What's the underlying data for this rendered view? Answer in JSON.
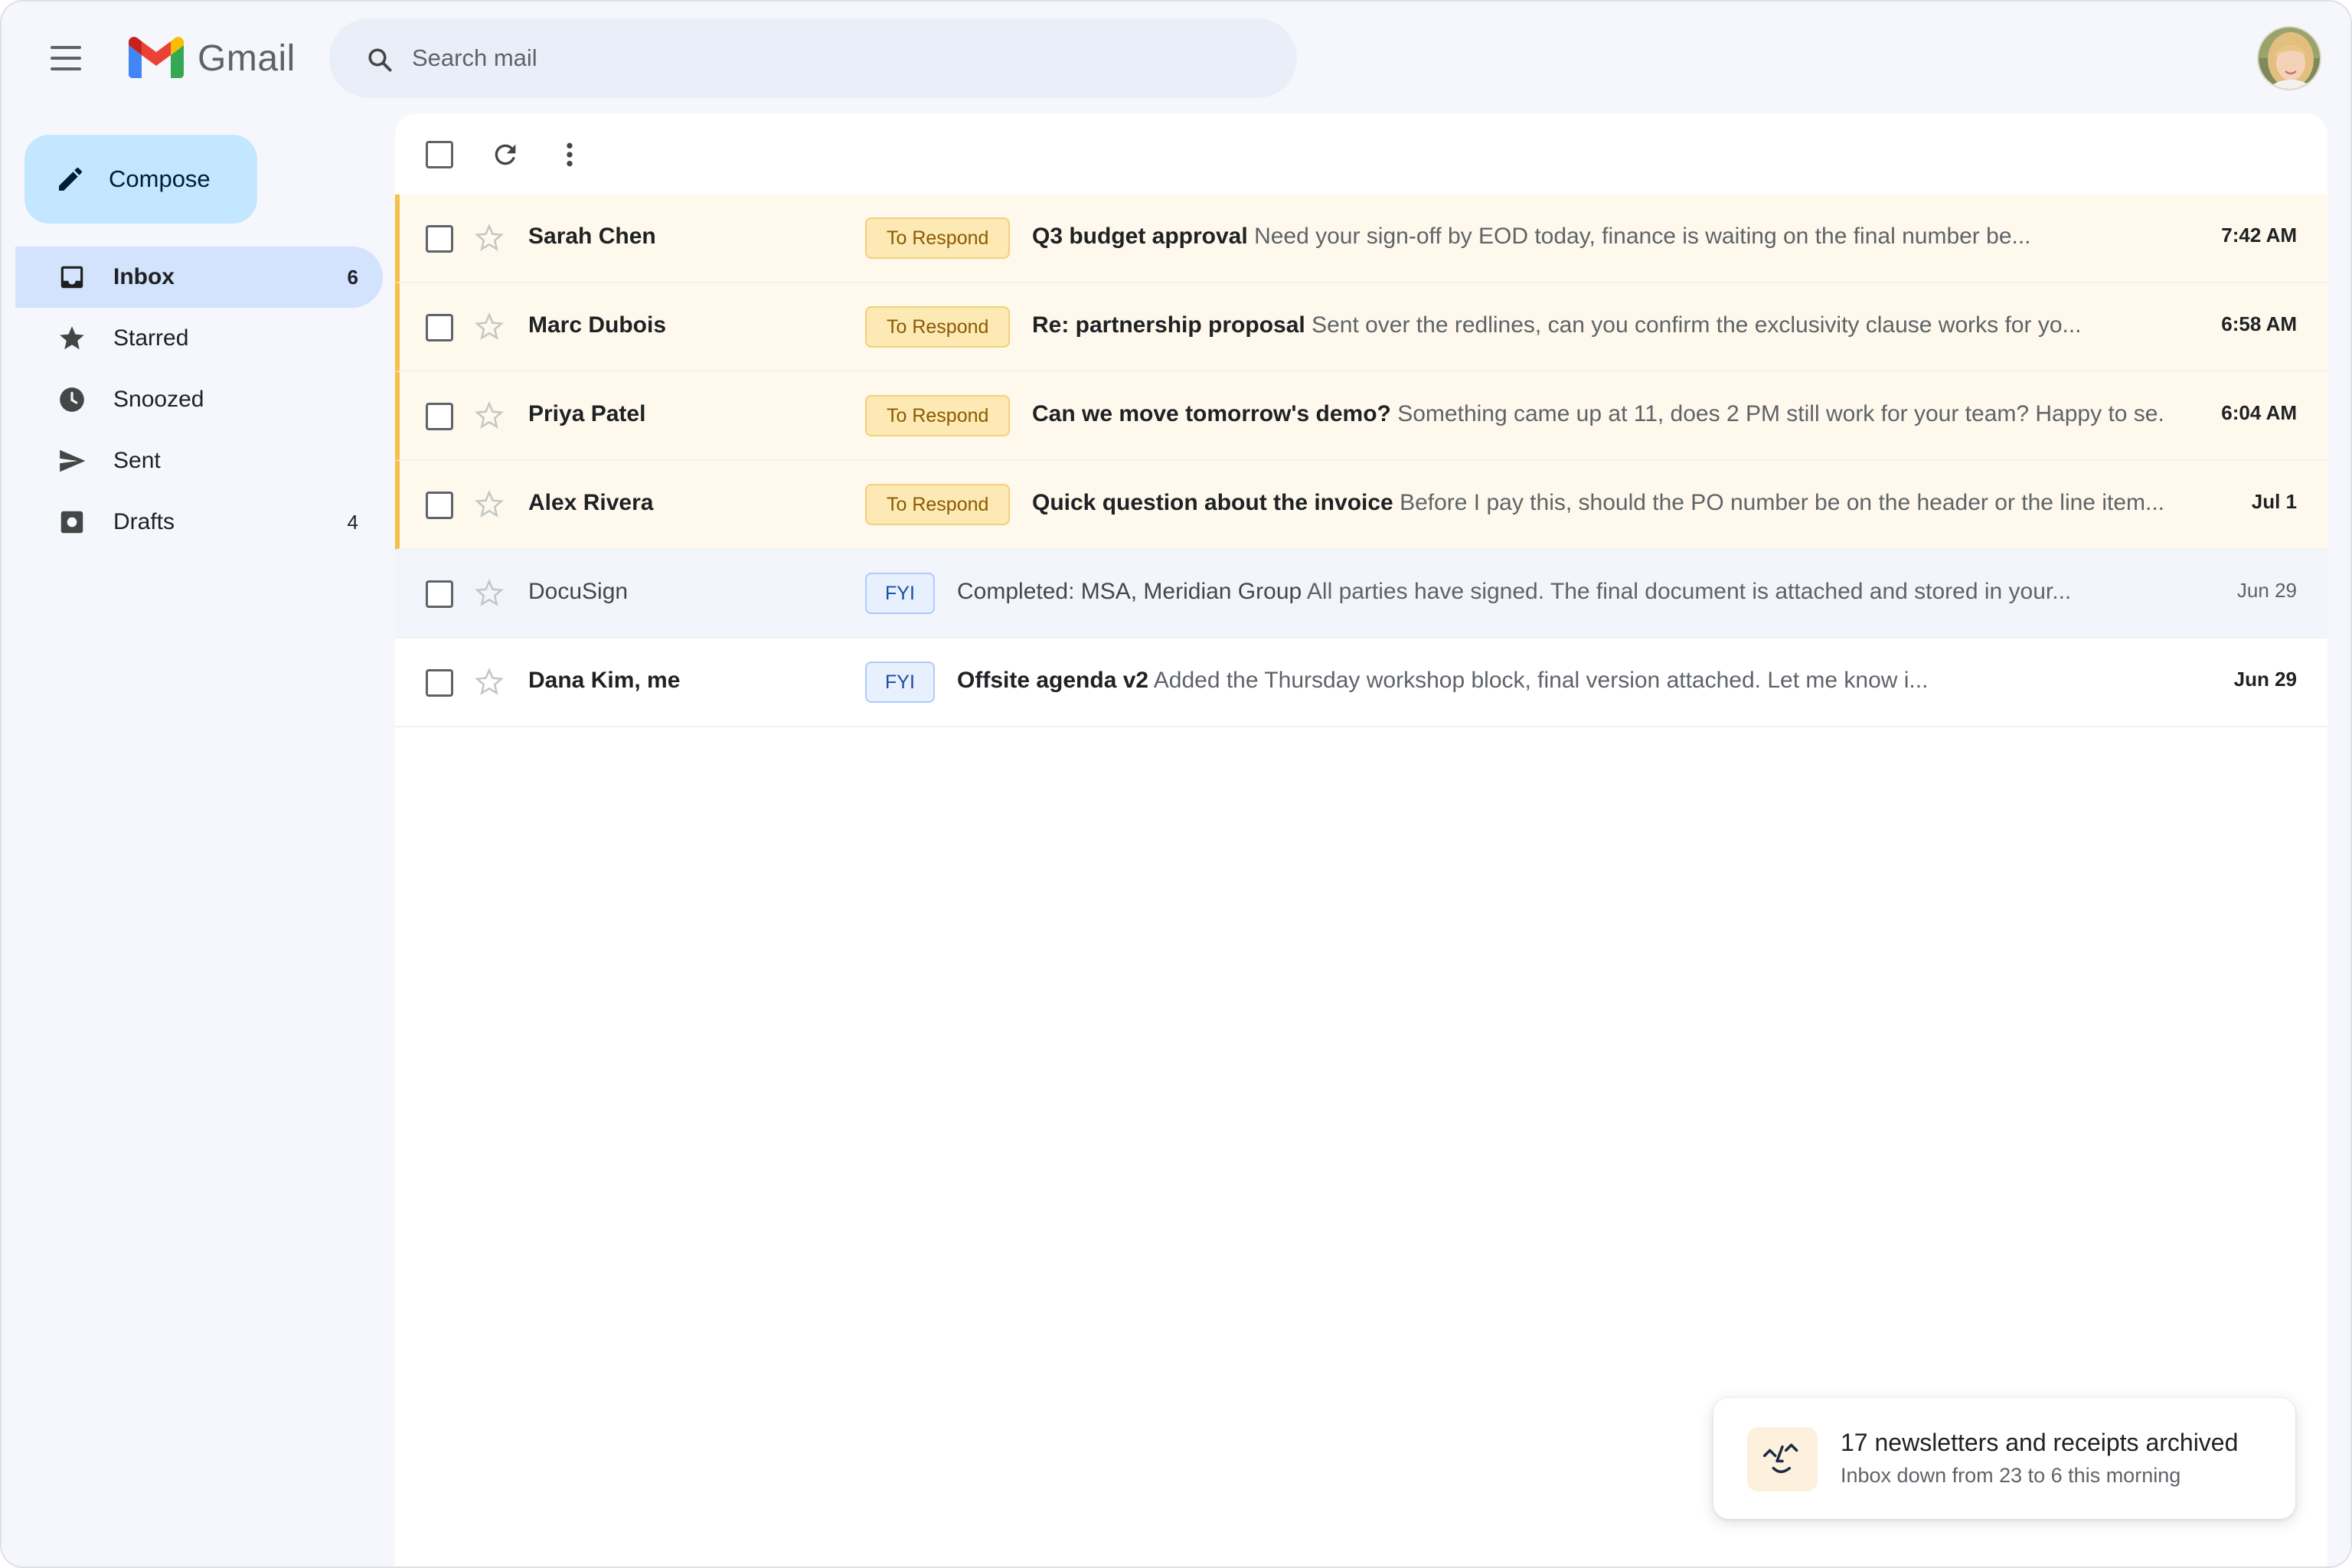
{
  "app": {
    "name": "Gmail"
  },
  "search": {
    "placeholder": "Search mail"
  },
  "compose": {
    "label": "Compose"
  },
  "sidebar": {
    "items": [
      {
        "label": "Inbox",
        "count": "6",
        "icon": "inbox-icon",
        "active": true
      },
      {
        "label": "Starred",
        "count": "",
        "icon": "star-icon",
        "active": false
      },
      {
        "label": "Snoozed",
        "count": "",
        "icon": "clock-icon",
        "active": false
      },
      {
        "label": "Sent",
        "count": "",
        "icon": "send-icon",
        "active": false
      },
      {
        "label": "Drafts",
        "count": "4",
        "icon": "draft-icon",
        "active": false
      }
    ]
  },
  "emails": [
    {
      "sender": "Sarah Chen",
      "label": "To Respond",
      "subject": "Q3 budget approval",
      "snippet": "Need your sign-off by EOD today, finance is waiting on the final number be...",
      "date": "7:42 AM",
      "unread": true
    },
    {
      "sender": "Marc Dubois",
      "label": "To Respond",
      "subject": "Re: partnership proposal",
      "snippet": "Sent over the redlines, can you confirm the exclusivity clause works for yo...",
      "date": "6:58 AM",
      "unread": true
    },
    {
      "sender": "Priya Patel",
      "label": "To Respond",
      "subject": "Can we move tomorrow's demo?",
      "snippet": "Something came up at 11, does 2 PM still work for your team? Happy to se...",
      "date": "6:04 AM",
      "unread": true
    },
    {
      "sender": "Alex Rivera",
      "label": "To Respond",
      "subject": "Quick question about the invoice",
      "snippet": "Before I pay this, should the PO number be on the header or the line item...",
      "date": "Jul 1",
      "unread": true
    },
    {
      "sender": "DocuSign",
      "label": "FYI",
      "subject": "Completed: MSA, Meridian Group",
      "snippet": "All parties have signed. The final document is attached and stored in your...",
      "date": "Jun 29",
      "unread": false
    },
    {
      "sender": "Dana Kim, me",
      "label": "FYI",
      "subject": "Offsite agenda v2",
      "snippet": "Added the Thursday workshop block, final version attached. Let me know i...",
      "date": "Jun 29",
      "unread": true
    }
  ],
  "toast": {
    "title": "17 newsletters and receipts archived",
    "subtitle": "Inbox down from 23 to 6 this morning"
  },
  "colors": {
    "respond_bg": "#fef9ec",
    "respond_accent": "#f6bf4a",
    "fyi_accent": "#174ea6",
    "active_nav": "#d3e3fd",
    "compose": "#c2e7ff"
  }
}
